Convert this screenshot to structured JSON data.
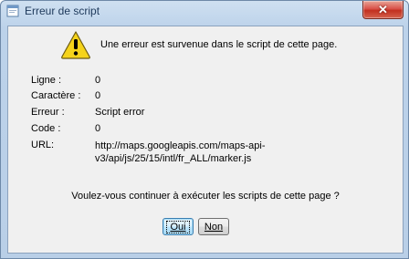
{
  "window": {
    "title": "Erreur de script",
    "close_glyph": "✕"
  },
  "dialog": {
    "message": "Une erreur est survenue dans le script de cette page.",
    "icon": "warning-icon",
    "details": [
      {
        "label": "Ligne :",
        "value": "0"
      },
      {
        "label": "Caractère :",
        "value": "0"
      },
      {
        "label": "Erreur :",
        "value": "Script error"
      },
      {
        "label": "Code :",
        "value": "0"
      },
      {
        "label": "URL:",
        "value": "http://maps.googleapis.com/maps-api-v3/api/js/25/15/intl/fr_ALL/marker.js"
      }
    ],
    "question": "Voulez-vous continuer à exécuter les scripts de cette page ?",
    "buttons": {
      "yes": "Oui",
      "no": "Non"
    }
  },
  "colors": {
    "frame": "#bcd2ea",
    "client": "#f0f0f0",
    "close": "#c8402f",
    "warning": "#f5d31a"
  }
}
